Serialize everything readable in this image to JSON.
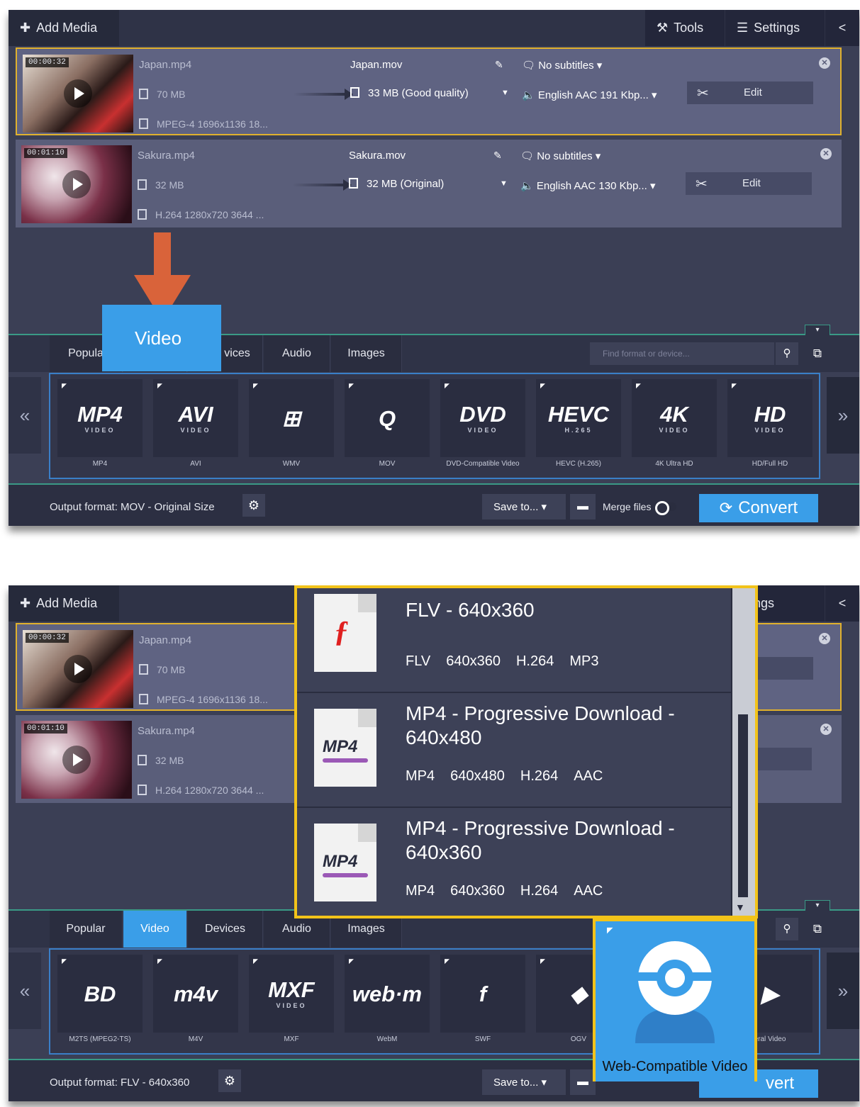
{
  "toolbar": {
    "add_media": "Add Media",
    "tools": "Tools",
    "settings": "Settings",
    "settings_partial": "ettings"
  },
  "files": [
    {
      "time": "00:00:32",
      "source_name": "Japan.mp4",
      "source_size": "70 MB",
      "source_info": "MPEG-4 1696x1136 18...",
      "output_name": "Japan.mov",
      "output_size": "33 MB (Good quality)",
      "subtitles": "No subtitles",
      "audio": "English AAC 191 Kbp...",
      "edit": "Edit"
    },
    {
      "time": "00:01:10",
      "source_name": "Sakura.mp4",
      "source_size": "32 MB",
      "source_info": "H.264 1280x720 3644 ...",
      "output_name": "Sakura.mov",
      "output_size": "32 MB (Original)",
      "subtitles": "No subtitles",
      "audio": "English AAC 130 Kbp...",
      "edit": "Edit"
    }
  ],
  "tabs": {
    "popular": "Popular",
    "popular_partial": "Popula",
    "video": "Video",
    "devices": "Devices",
    "devices_partial": "vices",
    "audio": "Audio",
    "images": "Images"
  },
  "search": {
    "placeholder": "Find format or device..."
  },
  "formats_top": [
    {
      "glyph": "MP4",
      "sub": "VIDEO",
      "label": "MP4"
    },
    {
      "glyph": "AVI",
      "sub": "VIDEO",
      "label": "AVI"
    },
    {
      "glyph": "⊞",
      "sub": "",
      "label": "WMV"
    },
    {
      "glyph": "Q",
      "sub": "",
      "label": "MOV"
    },
    {
      "glyph": "DVD",
      "sub": "VIDEO",
      "label": "DVD-Compatible Video"
    },
    {
      "glyph": "HEVC",
      "sub": "H.265",
      "label": "HEVC (H.265)"
    },
    {
      "glyph": "4K",
      "sub": "VIDEO",
      "label": "4K Ultra HD"
    },
    {
      "glyph": "HD",
      "sub": "VIDEO",
      "label": "HD/Full HD"
    }
  ],
  "formats_bottom": [
    {
      "glyph": "BD",
      "sub": "",
      "label": "M2TS (MPEG2-TS)"
    },
    {
      "glyph": "m4v",
      "sub": "",
      "label": "M4V"
    },
    {
      "glyph": "MXF",
      "sub": "VIDEO",
      "label": "MXF"
    },
    {
      "glyph": "web·m",
      "sub": "",
      "label": "WebM"
    },
    {
      "glyph": "f",
      "sub": "",
      "label": "SWF"
    },
    {
      "glyph": "◆",
      "sub": "",
      "label": "OGV"
    },
    {
      "glyph": "",
      "sub": "",
      "label": ""
    },
    {
      "glyph": "▶",
      "sub": "",
      "label": "eral Video"
    }
  ],
  "bottom_top": {
    "output_format": "Output format: MOV - Original Size",
    "save_to": "Save to...",
    "merge": "Merge files",
    "convert": "Convert"
  },
  "bottom_bottom": {
    "output_format": "Output format: FLV - 640x360",
    "save_to": "Save to...",
    "convert_partial": "vert"
  },
  "callout": {
    "label": "Video"
  },
  "dropdown": [
    {
      "title": "FLV - 640x360",
      "specs": [
        "FLV",
        "640x360",
        "H.264",
        "MP3"
      ]
    },
    {
      "title": "MP4 - Progressive Download - 640x480",
      "specs": [
        "MP4",
        "640x480",
        "H.264",
        "AAC"
      ]
    },
    {
      "title": "MP4 - Progressive Download - 640x360",
      "specs": [
        "MP4",
        "640x360",
        "H.264",
        "AAC"
      ]
    }
  ],
  "webcam_tile": {
    "label": "Web-Compatible Video"
  },
  "colors": {
    "accent": "#3a9ee8",
    "highlight": "#f2c31a",
    "arrow": "#d9633a"
  }
}
